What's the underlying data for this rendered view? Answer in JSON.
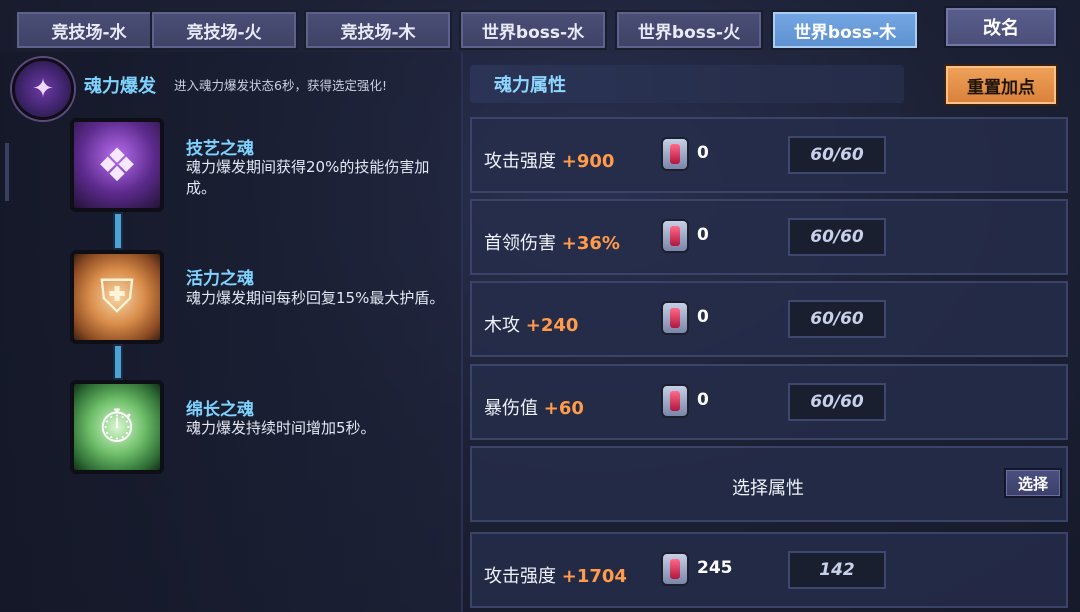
{
  "tabs": [
    {
      "label": "竞技场-水"
    },
    {
      "label": "竞技场-火"
    },
    {
      "label": "竞技场-木"
    },
    {
      "label": "世界boss-水"
    },
    {
      "label": "世界boss-火"
    },
    {
      "label": "世界boss-木",
      "active": true
    }
  ],
  "rename_label": "改名",
  "burst": {
    "title": "魂力爆发",
    "description": "进入魂力爆发状态6秒，获得选定强化!"
  },
  "skills": [
    {
      "name": "技艺之魂",
      "description": "魂力爆发期间获得20%的技能伤害加成。",
      "icon": "purple-crystal-icon"
    },
    {
      "name": "活力之魂",
      "description": "魂力爆发期间每秒回复15%最大护盾。",
      "icon": "shield-emblem-icon"
    },
    {
      "name": "绵长之魂",
      "description": "魂力爆发持续时间增加5秒。",
      "icon": "stopwatch-icon"
    }
  ],
  "attributes_header": "魂力属性",
  "reset_label": "重置加点",
  "attributes": [
    {
      "label": "攻击强度",
      "bonus": "+900",
      "gem_count": "0",
      "level": "60/60"
    },
    {
      "label": "首领伤害",
      "bonus": "+36%",
      "gem_count": "0",
      "level": "60/60"
    },
    {
      "label": "木攻",
      "bonus": "+240",
      "gem_count": "0",
      "level": "60/60"
    },
    {
      "label": "暴伤值",
      "bonus": "+60",
      "gem_count": "0",
      "level": "60/60"
    }
  ],
  "select_row": {
    "label": "选择属性",
    "button": "选择"
  },
  "extra_attribute": {
    "label": "攻击强度",
    "bonus": "+1704",
    "gem_count": "245",
    "level": "142"
  }
}
